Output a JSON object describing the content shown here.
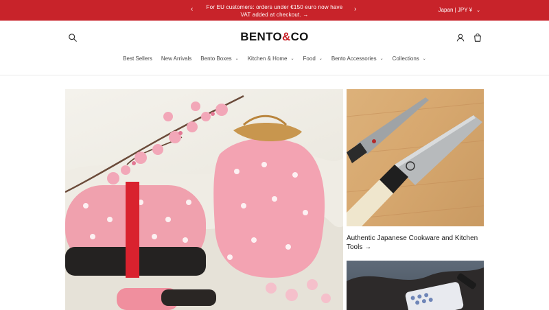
{
  "announcement": {
    "line1": "For EU customers: orders under €150 euro now have",
    "line2": "VAT added at checkout. →",
    "prev_icon": "chevron-left",
    "next_icon": "chevron-right"
  },
  "locale": {
    "label": "Japan | JPY ¥",
    "chevron": "⌄"
  },
  "brand": {
    "part1": "BENTO",
    "amp": "&",
    "part2": "CO",
    "accent_color": "#c8232a"
  },
  "nav": {
    "items": [
      {
        "label": "Best Sellers",
        "dropdown": false
      },
      {
        "label": "New Arrivals",
        "dropdown": false
      },
      {
        "label": "Bento Boxes",
        "dropdown": true
      },
      {
        "label": "Kitchen & Home",
        "dropdown": true
      },
      {
        "label": "Food",
        "dropdown": true
      },
      {
        "label": "Bento Accessories",
        "dropdown": true
      },
      {
        "label": "Collections",
        "dropdown": true
      }
    ]
  },
  "hero": {
    "feature_caption": "Authentic Japanese Cookware and Kitchen Tools →"
  },
  "colors": {
    "announcement_bg": "#c8232a",
    "text": "#2a2a2a"
  }
}
